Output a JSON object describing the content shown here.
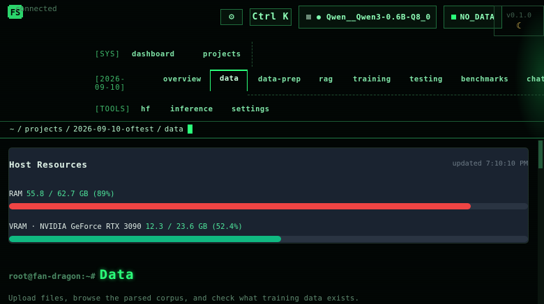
{
  "header": {
    "connection_status": "connected",
    "command_shortcut": "Ctrl K",
    "model_name": "Qwen__Qwen3-0.6B-Q8_0",
    "data_status": "NO_DATA",
    "version": "v0.1.0",
    "icons": {
      "settings": "gear-icon",
      "theme": "moon-icon",
      "logo": "fs-logo-icon"
    }
  },
  "nav": {
    "sys_label": "[SYS]",
    "sys_items": [
      "dashboard",
      "projects"
    ],
    "date_label": "[2026-09-10]",
    "date_items": [
      "overview",
      "data",
      "data-prep",
      "rag",
      "training",
      "testing",
      "benchmarks",
      "chat"
    ],
    "active_tab": "data",
    "tools_label": "[TOOLS]",
    "tools_items": [
      "hf",
      "inference",
      "settings"
    ]
  },
  "breadcrumb": [
    "~",
    "projects",
    "2026-09-10-oftest",
    "data"
  ],
  "resources": {
    "title": "Host Resources",
    "updated": "updated 7:10:10 PM",
    "ram": {
      "label": "RAM",
      "value": "55.8 / 62.7 GB (89%)",
      "fraction": 0.89,
      "color": "#ef4444"
    },
    "vram": {
      "label": "VRAM · NVIDIA GeForce RTX 3090",
      "value": "12.3 / 23.6 GB (52.4%)",
      "fraction": 0.524,
      "color": "#10b981"
    }
  },
  "page": {
    "prompt": "root@fan-dragon:~#",
    "title": "Data",
    "description": "Upload files, browse the parsed corpus, and check what training data exists."
  },
  "colors": {
    "accent": "#2bff7a",
    "background": "#020705",
    "panel": "#1a2330"
  }
}
